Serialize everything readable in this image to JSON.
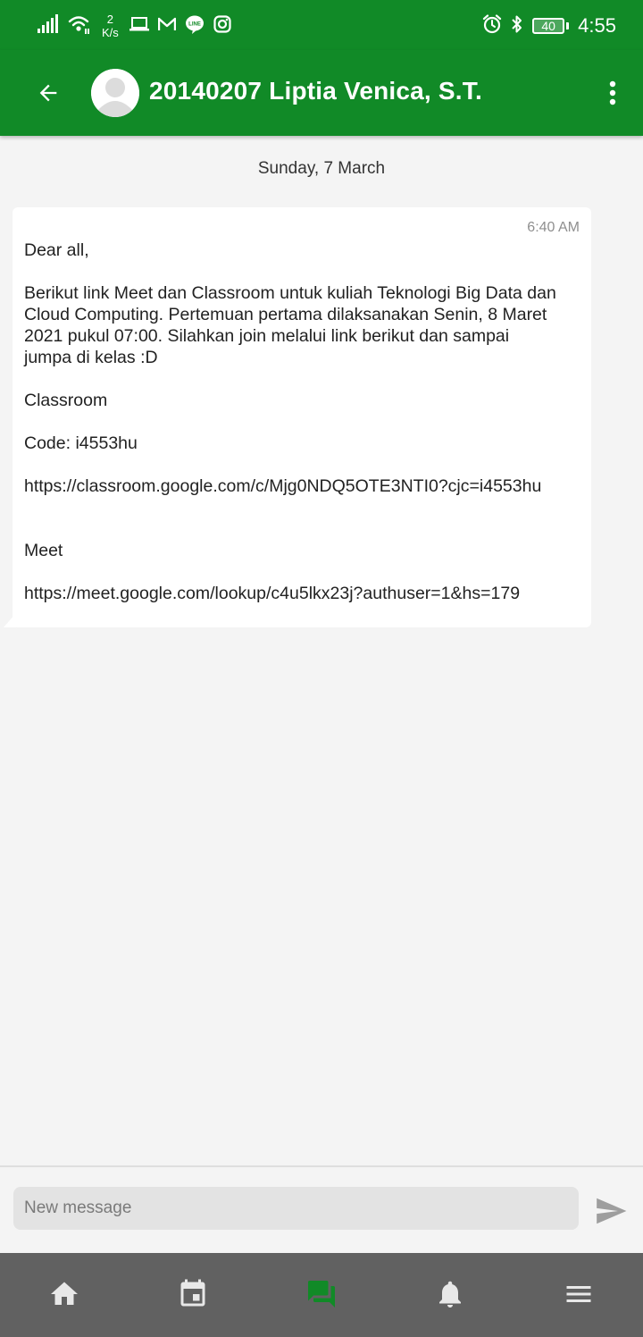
{
  "status_bar": {
    "net_speed_value": "2",
    "net_speed_unit": "K/s",
    "battery": "40",
    "time": "4:55",
    "icons": [
      "signal-icon",
      "wifi-icon",
      "laptop-icon",
      "gmail-icon",
      "line-icon",
      "instagram-icon",
      "alarm-icon",
      "bluetooth-icon",
      "battery-icon"
    ]
  },
  "header": {
    "title": "20140207 Liptia Venica, S.T.",
    "accent_color": "#118a27"
  },
  "conversation": {
    "date_separator": "Sunday, 7 March",
    "message": {
      "time": "6:40 AM",
      "greeting": "Dear all,",
      "body_lines": [
        "Berikut link Meet dan Classroom untuk kuliah Teknologi Big Data dan",
        "Cloud Computing. Pertemuan pertama dilaksanakan Senin, 8 Maret",
        "2021 pukul 07:00. Silahkan join melalui link berikut dan sampai",
        "jumpa di kelas :D"
      ],
      "classroom_heading": "Classroom",
      "classroom_code": "Code: i4553hu",
      "classroom_link": "https://classroom.google.com/c/Mjg0NDQ5OTE3NTI0?cjc=i4553hu",
      "meet_heading": "Meet",
      "meet_link": "https://meet.google.com/lookup/c4u5lkx23j?authuser=1&hs=179"
    }
  },
  "composer": {
    "placeholder": "New message",
    "value": ""
  },
  "bottom_nav": {
    "items": [
      "home-icon",
      "calendar-icon",
      "chat-icon",
      "notifications-icon",
      "menu-icon"
    ],
    "active": "chat-icon",
    "active_color": "#118a27",
    "inactive_color": "#e8e8e8"
  }
}
